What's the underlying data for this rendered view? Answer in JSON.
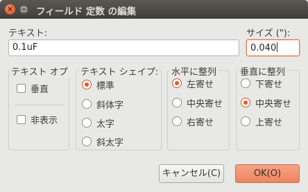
{
  "window": {
    "title": "フィールド 定数 の編集",
    "close_glyph": "×"
  },
  "text_field": {
    "label": "テキスト:",
    "value": "0.1uF"
  },
  "size_field": {
    "label": "サイズ (\"):",
    "value": "0.040"
  },
  "text_options": {
    "title": "テキスト オプ",
    "items": [
      "垂直",
      "非表示"
    ],
    "checked": [
      false,
      false
    ]
  },
  "text_shape": {
    "title": "テキスト シェイプ:",
    "items": [
      "標準",
      "斜体字",
      "太字",
      "斜太字"
    ],
    "selected": "標準"
  },
  "h_justify": {
    "title": "水平に整列",
    "items": [
      "左寄せ",
      "中央寄せ",
      "右寄せ"
    ],
    "selected": "左寄せ"
  },
  "v_justify": {
    "title": "垂直に整列",
    "items": [
      "下寄せ",
      "中央寄せ",
      "上寄せ"
    ],
    "selected": "中央寄せ"
  },
  "buttons": {
    "cancel": "キャンセル(C)",
    "ok": "OK(O)"
  },
  "colors": {
    "accent": "#e45a2b",
    "ok_button": "#ec8660",
    "titlebar": "#4a4944"
  }
}
